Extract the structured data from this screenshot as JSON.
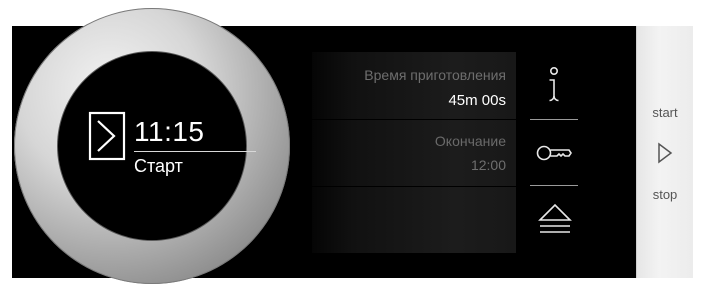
{
  "dial": {
    "time": "11:15",
    "mode_label": "Старт",
    "mode_icon": "play-outline-icon"
  },
  "info": {
    "cooking_time_label": "Время приготовления",
    "cooking_time_value": "45m 00s",
    "end_label": "Окончание",
    "end_value": "12:00"
  },
  "icons": {
    "info": "info-icon",
    "key": "key-lock-icon",
    "eject": "eject-icon"
  },
  "sidebar": {
    "start_label": "start",
    "stop_label": "stop",
    "play_icon": "play-outline-icon"
  },
  "colors": {
    "panel_bg": "#000000",
    "sidebar_bg": "#ececec",
    "text_primary": "#ffffff",
    "text_muted": "#6e6e6e"
  }
}
